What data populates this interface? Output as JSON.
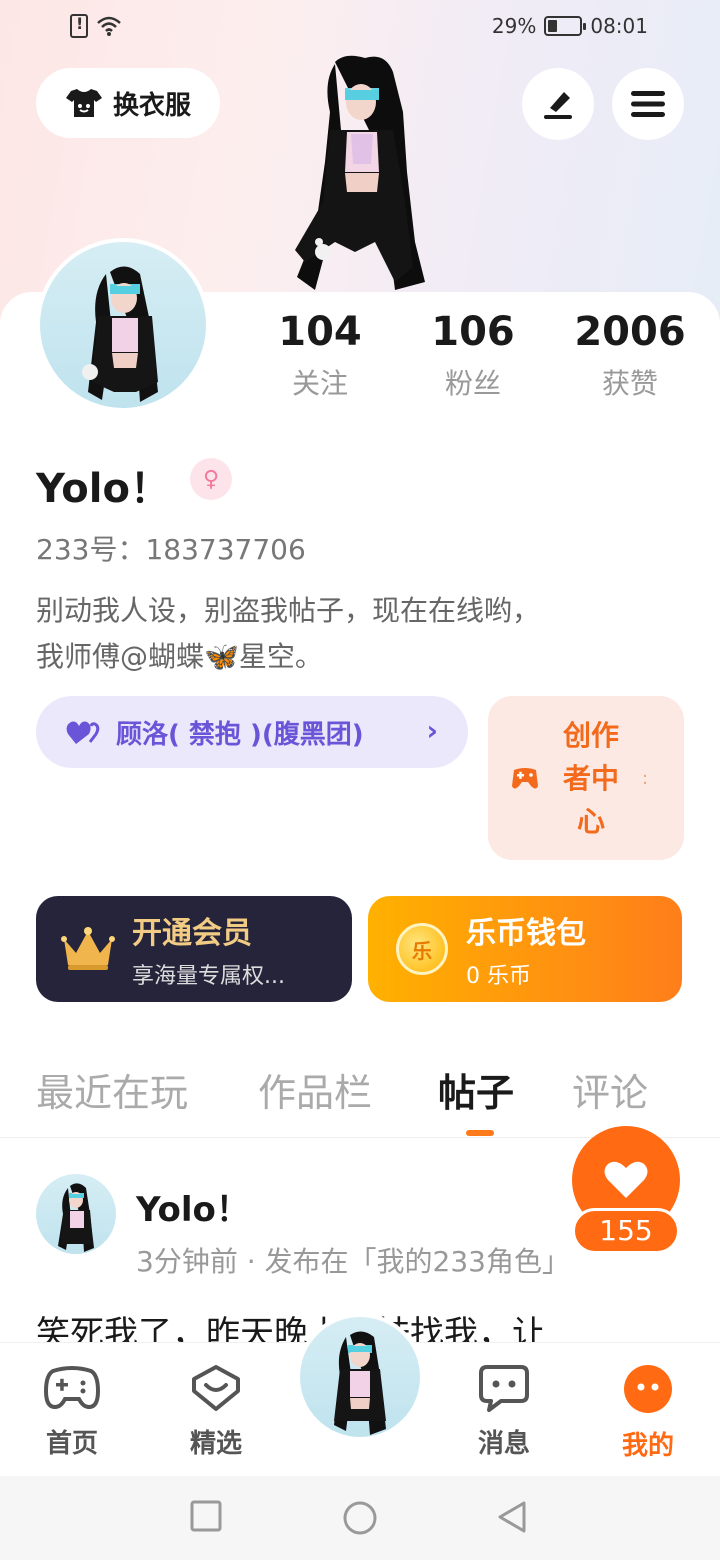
{
  "status_bar": {
    "battery": "29%",
    "time": "08:01"
  },
  "header": {
    "outfit_label": "换衣服"
  },
  "stats": [
    {
      "value": "104",
      "label": "关注"
    },
    {
      "value": "106",
      "label": "粉丝"
    },
    {
      "value": "2006",
      "label": "获赞"
    }
  ],
  "profile": {
    "username": "Yolo！",
    "gender_icon": "female-symbol",
    "uid": "233号：183737706",
    "bio_line1": "别动我人设，别盗我帖子，现在在线哟，",
    "bio_line2": "我师傅@蝴蝶🦋星空。"
  },
  "group": {
    "label": "顾洛( 禁抱 )(腹黑团)"
  },
  "creator": {
    "label": "创作者中心"
  },
  "vip": {
    "title": "开通会员",
    "subtitle": "享海量专属权..."
  },
  "wallet": {
    "title": "乐币钱包",
    "subtitle": "0 乐币",
    "coin_char": "乐"
  },
  "tabs": [
    "最近在玩",
    "作品栏",
    "帖子",
    "评论"
  ],
  "active_tab": "帖子",
  "post": {
    "author": "Yolo！",
    "meta": "3分钟前 · 发布在「我的233角色」",
    "text": "笑死我了，昨天晚上我妹找我，让",
    "likes": "155"
  },
  "bottom_nav": [
    {
      "label": "首页",
      "icon": "gamepad-icon"
    },
    {
      "label": "精选",
      "icon": "heart-box-icon"
    },
    {
      "label": "消息",
      "icon": "chat-icon"
    },
    {
      "label": "我的",
      "icon": "profile-face-icon"
    }
  ],
  "colors": {
    "accent": "#ff6a12",
    "group_purple": "#6a55d8",
    "vip_gold": "#f2cc84"
  }
}
